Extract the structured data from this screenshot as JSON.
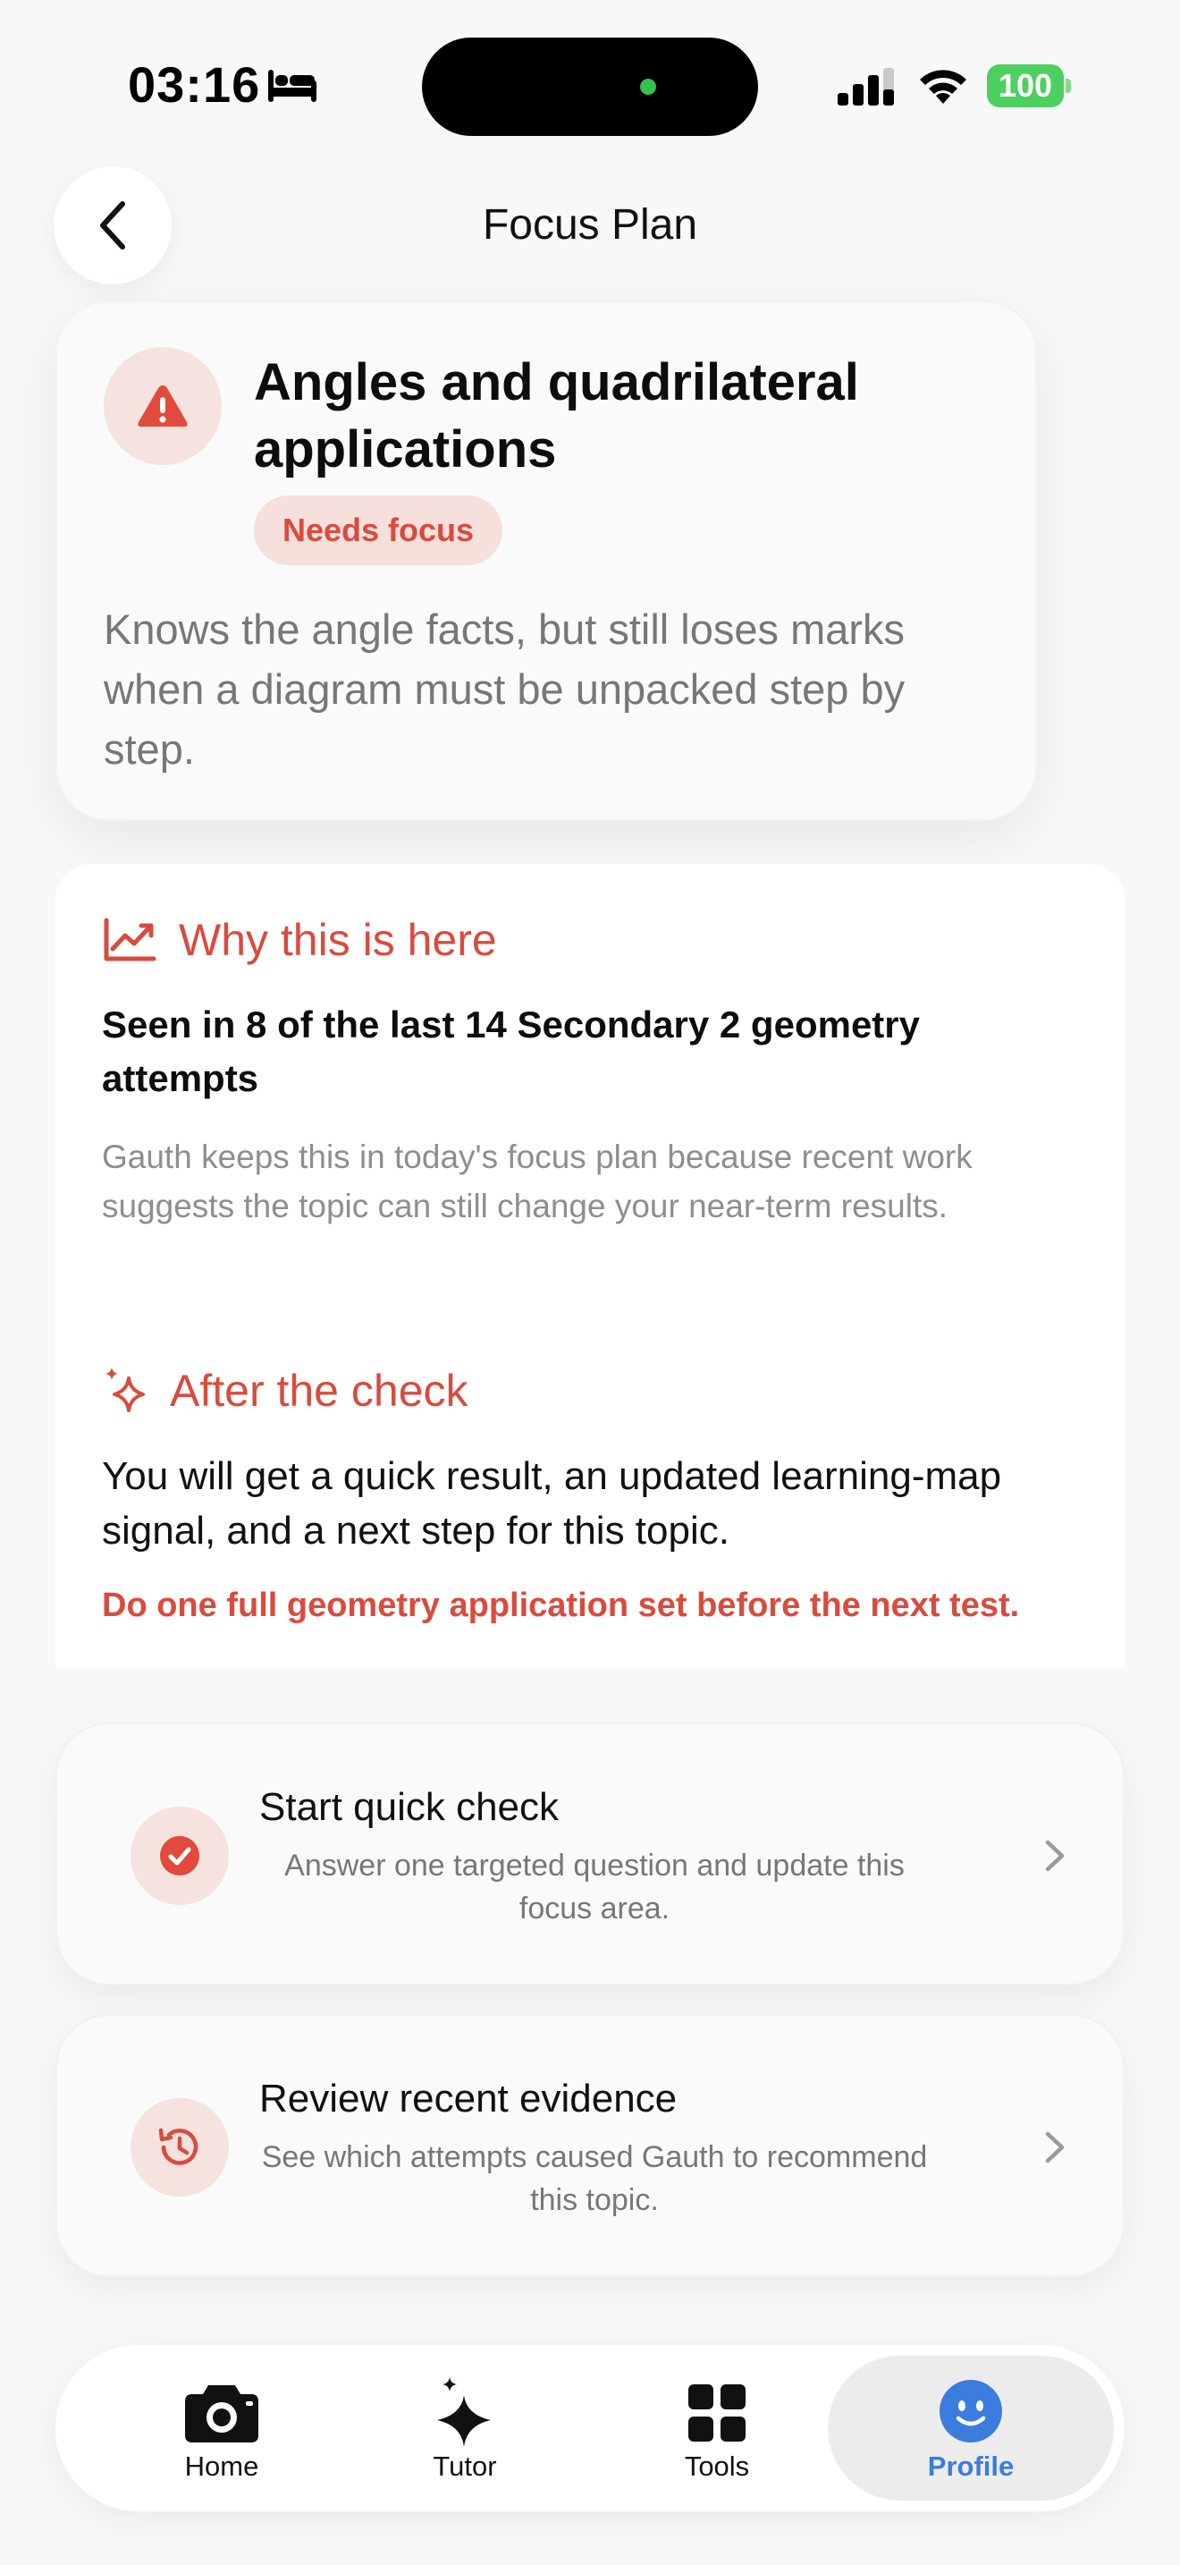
{
  "status_bar": {
    "time": "03:16",
    "battery": "100"
  },
  "header": {
    "title": "Focus Plan"
  },
  "topic": {
    "title": "Angles and quadrilateral applications",
    "badge": "Needs focus",
    "description": "Knows the angle facts, but still loses marks when a diagram must be unpacked step by step."
  },
  "why": {
    "heading": "Why this is here",
    "subheading": "Seen in 8 of the last 14 Secondary 2 geometry attempts",
    "description": "Gauth keeps this in today's focus plan because recent work suggests the topic can still change your near-term results."
  },
  "after": {
    "heading": "After the check",
    "subheading": "You will get a quick result, an updated learning-map signal, and a next step for this topic.",
    "action": "Do one full geometry application set before the next test."
  },
  "cards": {
    "quick_check": {
      "title": "Start quick check",
      "description": "Answer one targeted question and update this focus area."
    },
    "review": {
      "title": "Review recent evidence",
      "description": "See which attempts caused Gauth to recommend this topic."
    }
  },
  "tabs": {
    "home": "Home",
    "tutor": "Tutor",
    "tools": "Tools",
    "profile": "Profile"
  },
  "colors": {
    "accent": "#d94b3d",
    "accent_bg": "#f6e2df",
    "active_tab": "#3a7ddd",
    "battery": "#4cd05f"
  }
}
